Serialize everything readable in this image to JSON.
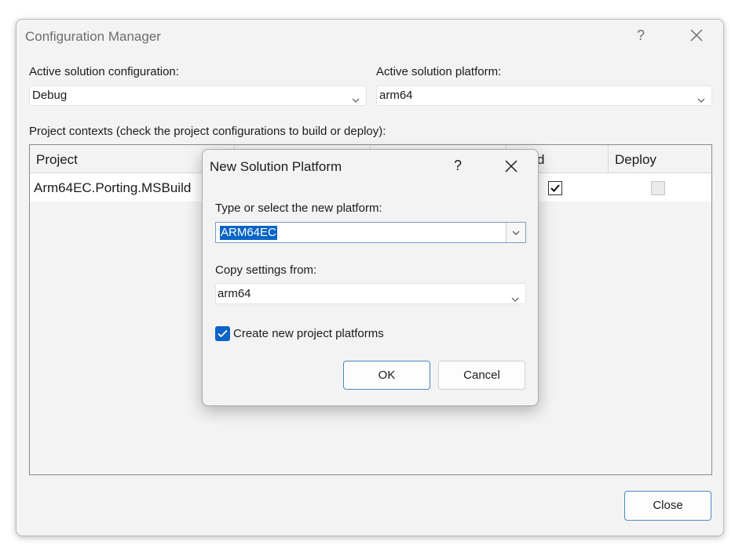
{
  "main_window": {
    "title": "Configuration Manager",
    "help_glyph": "?",
    "active_config_label": "Active solution configuration:",
    "active_config_value": "Debug",
    "active_platform_label": "Active solution platform:",
    "active_platform_value": "arm64",
    "project_contexts_label": "Project contexts (check the project configurations to build or deploy):",
    "grid": {
      "columns": [
        "Project",
        "d",
        "Deploy"
      ],
      "rows": [
        {
          "project": "Arm64EC.Porting.MSBuild",
          "build_checked": true,
          "deploy_checked": false
        }
      ]
    },
    "close_label": "Close"
  },
  "dialog": {
    "title": "New Solution Platform",
    "help_glyph": "?",
    "platform_label": "Type or select the new platform:",
    "platform_value": "ARM64EC",
    "copy_label": "Copy settings from:",
    "copy_value": "arm64",
    "create_platforms_label": "Create new project platforms",
    "create_platforms_checked": true,
    "ok_label": "OK",
    "cancel_label": "Cancel"
  },
  "icons": {
    "close": "close-icon",
    "chevron": "chevron-down-icon",
    "check": "checkmark-icon"
  },
  "colors": {
    "accent": "#0a64c8",
    "window_bg": "#f3f3f3"
  }
}
